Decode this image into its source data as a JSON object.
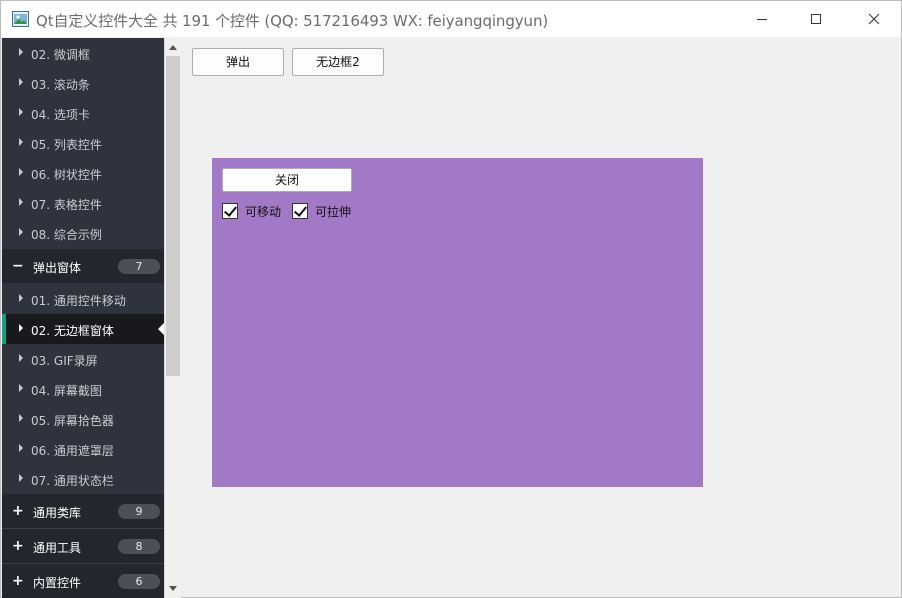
{
  "window": {
    "title": "Qt自定义控件大全 共 191 个控件 (QQ: 517216493 WX: feiyangqingyun)",
    "icons": {
      "app": "picture-icon",
      "minimize": "minimize-icon",
      "maximize": "maximize-icon",
      "close": "close-icon"
    }
  },
  "sidebar": {
    "items_top": [
      {
        "label": "02. 微调框"
      },
      {
        "label": "03. 滚动条"
      },
      {
        "label": "04. 选项卡"
      },
      {
        "label": "05. 列表控件"
      },
      {
        "label": "06. 树状控件"
      },
      {
        "label": "07. 表格控件"
      },
      {
        "label": "08. 综合示例"
      }
    ],
    "group_popup": {
      "icon": "−",
      "label": "弹出窗体",
      "count": "7"
    },
    "items_popup": [
      {
        "label": "01. 通用控件移动"
      },
      {
        "label": "02. 无边框窗体",
        "selected": true
      },
      {
        "label": "03. GIF录屏"
      },
      {
        "label": "04. 屏幕截图"
      },
      {
        "label": "05. 屏幕拾色器"
      },
      {
        "label": "06. 通用遮罩层"
      },
      {
        "label": "07. 通用状态栏"
      }
    ],
    "groups_bottom": [
      {
        "icon": "+",
        "label": "通用类库",
        "count": "9"
      },
      {
        "icon": "+",
        "label": "通用工具",
        "count": "8"
      },
      {
        "icon": "+",
        "label": "内置控件",
        "count": "6"
      }
    ],
    "colors": {
      "background": "#2f333d",
      "group_background": "#23262c",
      "selected_background": "#17191d",
      "accent": "#16a085"
    }
  },
  "toolbar": {
    "popup_label": "弹出",
    "frameless2_label": "无边框2"
  },
  "frameless_widget": {
    "background": "#a279c6",
    "close_label": "关闭",
    "checkbox_move": {
      "label": "可移动",
      "checked": true
    },
    "checkbox_resize": {
      "label": "可拉伸",
      "checked": true
    }
  }
}
